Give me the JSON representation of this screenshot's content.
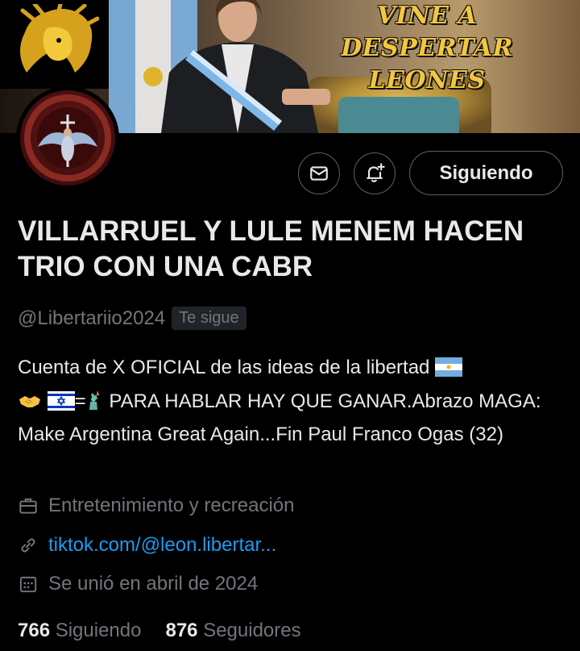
{
  "banner": {
    "headline_line1": "VINE A DESPERTAR",
    "headline_line2": "LEONES"
  },
  "actions": {
    "message_icon": "envelope-icon",
    "notify_icon": "bell-plus-icon",
    "following_label": "Siguiendo"
  },
  "profile": {
    "display_name": "VILLARRUEL Y LULE MENEM HACEN TRIO CON UNA CABR",
    "handle": "@Libertariio2024",
    "follows_you": "Te sigue",
    "bio_part1": "Cuenta de X  OFICIAL de las ideas de la libertad ",
    "bio_part2": "=",
    "bio_part3": " PARA HABLAR HAY QUE GANAR.Abrazo MAGA: Make Argentina Great Again...Fin Paul Franco Ogas (32)",
    "category": "Entretenimiento y recreación",
    "website": "tiktok.com/@leon.libertar...",
    "joined": "Se unió en abril de 2024"
  },
  "stats": {
    "following_count": "766",
    "following_label": "Siguiendo",
    "followers_count": "876",
    "followers_label": "Seguidores"
  },
  "colors": {
    "background": "#000000",
    "text": "#e7e9ea",
    "muted": "#71767b",
    "link": "#1d9bf0",
    "border": "#536471"
  }
}
